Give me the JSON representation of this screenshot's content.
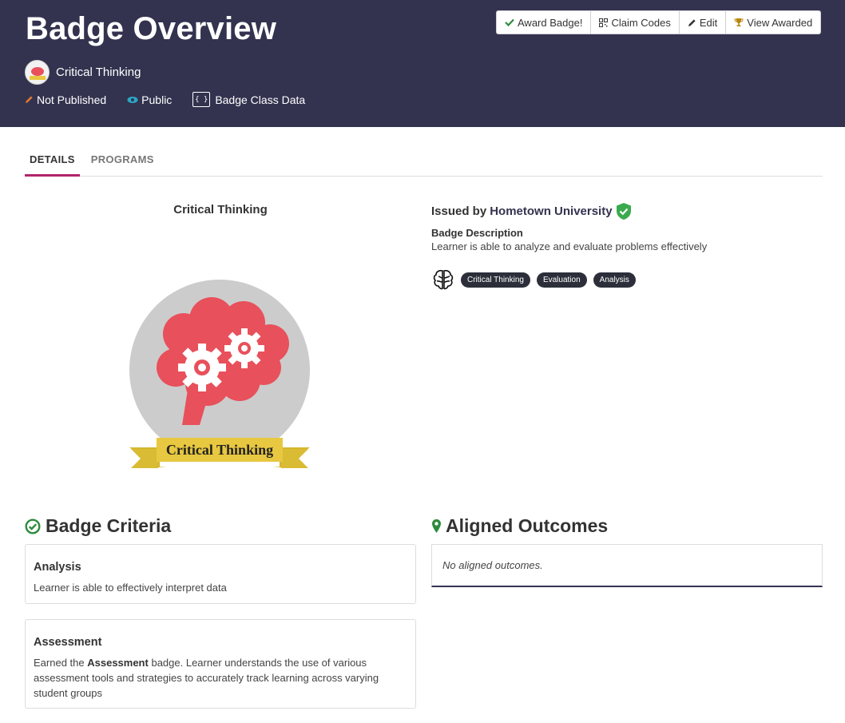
{
  "header": {
    "title": "Badge Overview",
    "badge_name": "Critical Thinking",
    "meta": {
      "published": "Not Published",
      "visibility": "Public",
      "class_data": "Badge Class Data",
      "json_icon_text": "{ }"
    },
    "actions": {
      "award": "Award Badge!",
      "claim_codes": "Claim Codes",
      "edit": "Edit",
      "view_awarded": "View Awarded"
    }
  },
  "tabs": [
    {
      "label": "DETAILS",
      "active": true
    },
    {
      "label": "PROGRAMS",
      "active": false
    }
  ],
  "badge": {
    "title": "Critical Thinking",
    "ribbon_text": "Critical Thinking"
  },
  "issuer": {
    "issued_by_label": "Issued by",
    "name": "Hometown University"
  },
  "description": {
    "label": "Badge Description",
    "text": "Learner is able to analyze and evaluate problems effectively"
  },
  "tags": [
    "Critical Thinking",
    "Evaluation",
    "Analysis"
  ],
  "criteria": {
    "heading": "Badge Criteria",
    "items": [
      {
        "title": "Analysis",
        "text": "Learner is able to effectively interpret data"
      },
      {
        "title": "Assessment",
        "text_before": "Earned the",
        "text_bold": "Assessment",
        "text_after": "badge. Learner understands the use of various assessment tools and strategies to accurately track learning across varying student groups"
      }
    ]
  },
  "outcomes": {
    "heading": "Aligned Outcomes",
    "empty_text": "No aligned outcomes."
  },
  "colors": {
    "header_bg": "#333350",
    "tab_accent": "#b3246a",
    "success_green": "#2e8b3e",
    "tag_bg": "#2c2f3a",
    "brain_red": "#e8505b",
    "ribbon_yellow": "#e8c840"
  },
  "icons": {
    "award": "check-icon",
    "claim_codes": "qr-code-icon",
    "edit": "pencil-icon",
    "view_awarded": "trophy-icon",
    "published": "pencil-icon",
    "visibility": "eye-icon",
    "class_data": "json-braces-icon",
    "issuer_verified": "verified-shield-icon",
    "tags": "brain-icon",
    "criteria": "check-circle-icon",
    "outcomes": "map-marker-icon"
  }
}
